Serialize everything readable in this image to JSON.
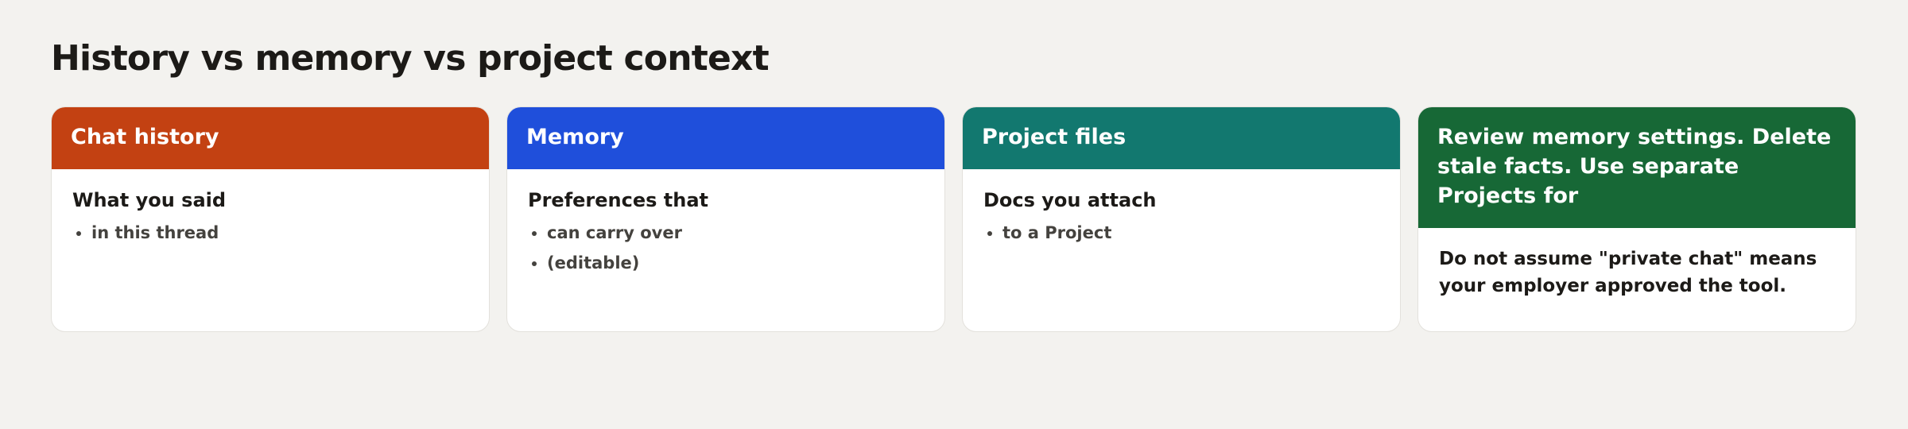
{
  "page": {
    "title": "History vs memory vs project context"
  },
  "cards": [
    {
      "header": "Chat history",
      "color": "#c34112",
      "lead": "What you said",
      "bullets": [
        "in this thread"
      ]
    },
    {
      "header": "Memory",
      "color": "#1f4fdb",
      "lead": "Preferences that",
      "bullets": [
        "can carry over",
        "(editable)"
      ]
    },
    {
      "header": "Project files",
      "color": "#12786f",
      "lead": "Docs you attach",
      "bullets": [
        "to a Project"
      ]
    },
    {
      "header": "Review memory settings. Delete stale facts. Use separate Projects for",
      "color": "#176836",
      "note": "Do not assume \"private chat\" means your employer approved the tool."
    }
  ]
}
